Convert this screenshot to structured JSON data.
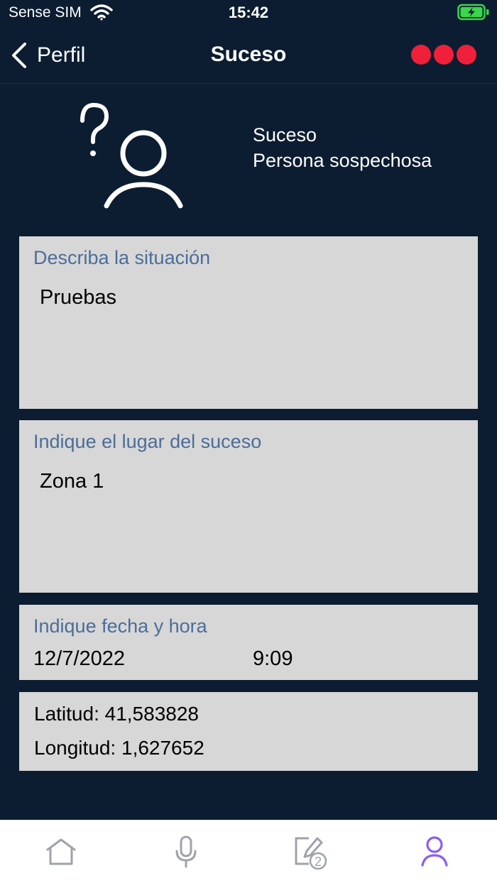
{
  "status_bar": {
    "carrier": "Sense SIM",
    "time": "15:42",
    "battery_color": "#3ad74a"
  },
  "nav": {
    "back_label": "Perfil",
    "title": "Suceso",
    "menu_dot_color": "#f0203a"
  },
  "header": {
    "line1": "Suceso",
    "line2": "Persona sospechosa",
    "icon": "unknown-person-icon"
  },
  "situacion": {
    "label": "Describa la situación",
    "value": "Pruebas"
  },
  "lugar": {
    "label": "Indique el lugar del suceso",
    "value": "Zona 1"
  },
  "fecha": {
    "label": "Indique fecha y hora",
    "date": "12/7/2022",
    "time": "9:09"
  },
  "coords": {
    "latitud": "Latitud: 41,583828",
    "longitud": "Longitud: 1,627652"
  },
  "tab_bar": {
    "tabs": [
      {
        "icon": "home-icon",
        "active": false
      },
      {
        "icon": "microphone-icon",
        "active": false
      },
      {
        "icon": "edit-document-icon",
        "active": false,
        "badge": "2"
      },
      {
        "icon": "user-icon",
        "active": true
      }
    ],
    "inactive_color": "#9ea3ab",
    "active_color": "#8a5cf5"
  }
}
